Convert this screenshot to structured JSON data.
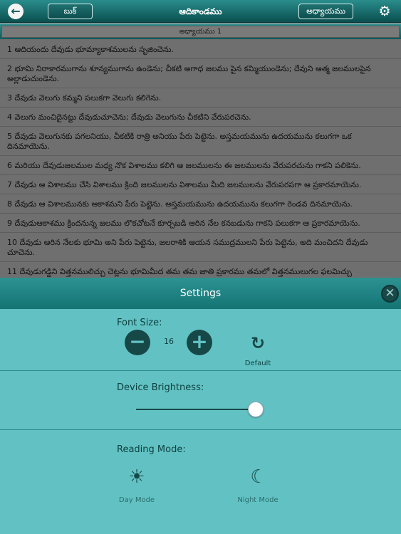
{
  "navbar": {
    "back_glyph": "←",
    "book_label": "బుక్",
    "title": "ఆదికాండము",
    "chapter_label": "అధ్యాయము",
    "gear_glyph": "⚙"
  },
  "chapter_strip": {
    "label": "అధ్యాయము 1"
  },
  "verses": [
    "1 ఆదియందు దేవుడు భూమ్యాకాశములను సృజించెను.",
    "2 భూమి నిరాకారముగాను శూన్యముగాను ఉండెను; చీకటి అగాధ జలము పైన కమ్మియుండెను; దేవుని ఆత్మ జలములపైన అల్లాడుచుండెను.",
    "3 దేవుడు వెలుగు కమ్మని పలుకగా వెలుగు కలిగెను.",
    "4 వెలుగు మంచిదైనట్టు దేవుడుచూచెను; దేవుడు వెలుగును చీకటిని వేరుపరచెను.",
    "5 దేవుడు వెలుగునకు పగలనియు, చీకటికి రాత్రి అనియు పేరు పెట్టెను. అస్తమయమును ఉదయమును కలుగగా ఒక దినమాయెను.",
    "6 మరియు దేవుడుజలముల మధ్య నొక విశాలము కలిగి ఆ జలములను ఈ జలములను వేరుపరచును గాకని పలికెను.",
    "7 దేవుడు ఆ విశాలము చేసి విశాలము క్రింది జలములను విశాలము మీది జలములను వేరుపరపగా ఆ ప్రకారమాయెను.",
    "8 దేవుడు ఆ విశాలమునకు ఆకాశమని పేరు పెట్టెను. అస్తమయమును ఉదయమును కలుగగా రెండవ దినమాయెను.",
    "9 దేవుడుఆకాశము క్రిందనున్న జలము లొకచోటనే కూర్చబడి ఆరిన నేల కనబడును గాకని పలుకగా ఆ ప్రకారమాయెను.",
    "10 దేవుడు ఆరిన నేలకు భూమి అని పేరు పెట్టెను, జలరాశికి ఆయన సముద్రములని పేరు పెట్టెను, అది మంచిదని దేవుడు చూచెను.",
    "11 దేవుడుగడ్డిని విత్తనములిచ్చు చెట్లను భూమిమీద తమ తమ జాతి ప్రకారము తమలో విత్తనములుగల ఫలమిచ్చు"
  ],
  "settings": {
    "title": "Settings",
    "close_glyph": "✕",
    "font_size": {
      "label": "Font Size:",
      "decrease_glyph": "−",
      "value": "16",
      "increase_glyph": "+",
      "reset_glyph": "↻",
      "reset_label": "Default"
    },
    "brightness": {
      "label": "Device Brightness:",
      "level": 1.0
    },
    "reading_mode": {
      "label": "Reading Mode:",
      "day_glyph": "☀",
      "day_label": "Day Mode",
      "night_glyph": "☾",
      "night_label": "Night Mode"
    }
  },
  "colors": {
    "nav": "#0b4f4f",
    "panel": "#62c2c3",
    "dark_control": "#174848"
  }
}
